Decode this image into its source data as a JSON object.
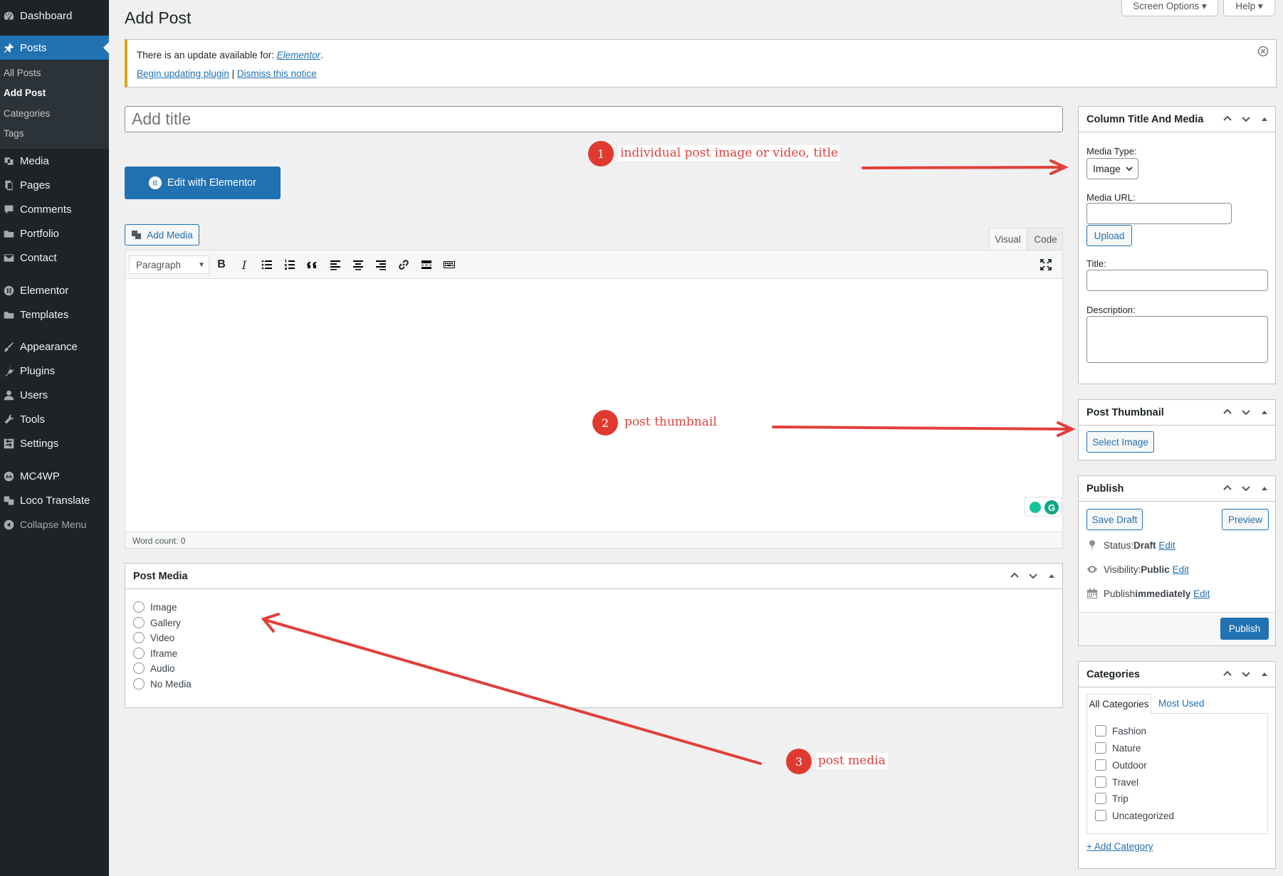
{
  "sidebar": {
    "items": [
      {
        "label": "Dashboard",
        "icon": "dashboard-icon"
      },
      {
        "label": "Posts",
        "icon": "pin-icon"
      },
      {
        "label": "Media",
        "icon": "media-icon"
      },
      {
        "label": "Pages",
        "icon": "pages-icon"
      },
      {
        "label": "Comments",
        "icon": "comments-icon"
      },
      {
        "label": "Portfolio",
        "icon": "folder-icon"
      },
      {
        "label": "Contact",
        "icon": "mail-icon"
      },
      {
        "label": "Elementor",
        "icon": "elementor-icon"
      },
      {
        "label": "Templates",
        "icon": "folder-icon"
      },
      {
        "label": "Appearance",
        "icon": "brush-icon"
      },
      {
        "label": "Plugins",
        "icon": "plugin-icon"
      },
      {
        "label": "Users",
        "icon": "users-icon"
      },
      {
        "label": "Tools",
        "icon": "wrench-icon"
      },
      {
        "label": "Settings",
        "icon": "settings-icon"
      },
      {
        "label": "MC4WP",
        "icon": "mc4wp-icon"
      },
      {
        "label": "Loco Translate",
        "icon": "translate-icon"
      },
      {
        "label": "Collapse Menu",
        "icon": "collapse-icon"
      }
    ],
    "submenu": [
      "All Posts",
      "Add Post",
      "Categories",
      "Tags"
    ]
  },
  "header": {
    "title": "Add Post",
    "screen_options": "Screen Options ▾",
    "help": "Help ▾"
  },
  "notice": {
    "text": "There is an update available for: ",
    "plugin": "Elementor",
    "period": ".",
    "begin": "Begin updating plugin",
    "sep": " | ",
    "dismiss": "Dismiss this notice"
  },
  "editor": {
    "title_placeholder": "Add title",
    "elementor_button": "Edit with Elementor",
    "add_media": "Add Media",
    "tab_visual": "Visual",
    "tab_code": "Code",
    "format_select": "Paragraph",
    "word_count": "Word count: 0"
  },
  "post_media": {
    "title": "Post Media",
    "options": [
      "Image",
      "Gallery",
      "Video",
      "Iframe",
      "Audio",
      "No Media"
    ]
  },
  "column_box": {
    "title": "Column Title And Media",
    "media_type_label": "Media Type:",
    "media_type_value": "Image",
    "media_url_label": "Media URL:",
    "upload": "Upload",
    "title_label": "Title:",
    "description_label": "Description:"
  },
  "thumbnail": {
    "title": "Post Thumbnail",
    "select": "Select Image"
  },
  "publish": {
    "title": "Publish",
    "save_draft": "Save Draft",
    "preview": "Preview",
    "status_label": "Status: ",
    "status_value": "Draft",
    "visibility_label": "Visibility: ",
    "visibility_value": "Public",
    "publish_label": "Publish ",
    "publish_value": "immediately",
    "edit": "Edit",
    "publish_button": "Publish"
  },
  "categories": {
    "title": "Categories",
    "tab_all": "All Categories",
    "tab_used": "Most Used",
    "items": [
      "Fashion",
      "Nature",
      "Outdoor",
      "Travel",
      "Trip",
      "Uncategorized"
    ],
    "add": "+ Add Category"
  },
  "annotations": [
    {
      "num": "1",
      "text": "individual post  image or video,  title"
    },
    {
      "num": "2",
      "text": "post thumbnail"
    },
    {
      "num": "3",
      "text": "post media"
    }
  ],
  "colors": {
    "accent": "#2271b1",
    "sidebar": "#1d2327",
    "annotation": "#e0403a"
  }
}
